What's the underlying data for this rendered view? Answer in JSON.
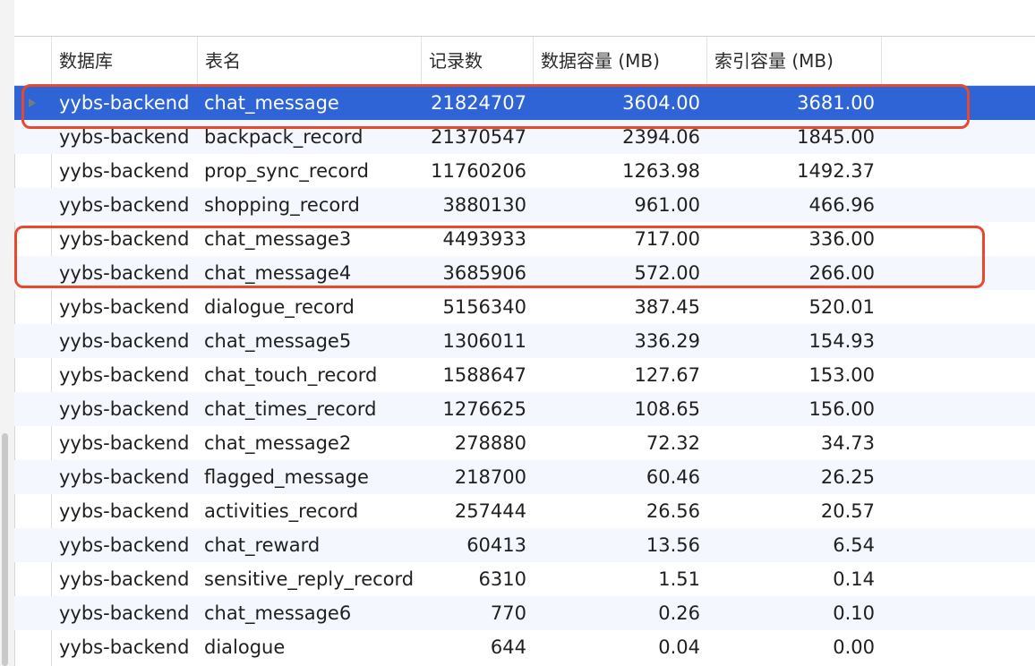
{
  "columns": {
    "database": "数据库",
    "table": "表名",
    "records": "记录数",
    "data_size": "数据容量 (MB)",
    "index_size": "索引容量 (MB)"
  },
  "rows": [
    {
      "db": "yybs-backend",
      "table": "chat_message",
      "records": "21824707",
      "data": "3604.00",
      "index": "3681.00",
      "selected": true,
      "highlighted": true
    },
    {
      "db": "yybs-backend",
      "table": "backpack_record",
      "records": "21370547",
      "data": "2394.06",
      "index": "1845.00"
    },
    {
      "db": "yybs-backend",
      "table": "prop_sync_record",
      "records": "11760206",
      "data": "1263.98",
      "index": "1492.37"
    },
    {
      "db": "yybs-backend",
      "table": "shopping_record",
      "records": "3880130",
      "data": "961.00",
      "index": "466.96"
    },
    {
      "db": "yybs-backend",
      "table": "chat_message3",
      "records": "4493933",
      "data": "717.00",
      "index": "336.00",
      "highlighted": true
    },
    {
      "db": "yybs-backend",
      "table": "chat_message4",
      "records": "3685906",
      "data": "572.00",
      "index": "266.00",
      "highlighted": true
    },
    {
      "db": "yybs-backend",
      "table": "dialogue_record",
      "records": "5156340",
      "data": "387.45",
      "index": "520.01"
    },
    {
      "db": "yybs-backend",
      "table": "chat_message5",
      "records": "1306011",
      "data": "336.29",
      "index": "154.93"
    },
    {
      "db": "yybs-backend",
      "table": "chat_touch_record",
      "records": "1588647",
      "data": "127.67",
      "index": "153.00"
    },
    {
      "db": "yybs-backend",
      "table": "chat_times_record",
      "records": "1276625",
      "data": "108.65",
      "index": "156.00"
    },
    {
      "db": "yybs-backend",
      "table": "chat_message2",
      "records": "278880",
      "data": "72.32",
      "index": "34.73"
    },
    {
      "db": "yybs-backend",
      "table": "flagged_message",
      "records": "218700",
      "data": "60.46",
      "index": "26.25"
    },
    {
      "db": "yybs-backend",
      "table": "activities_record",
      "records": "257444",
      "data": "26.56",
      "index": "20.57"
    },
    {
      "db": "yybs-backend",
      "table": "chat_reward",
      "records": "60413",
      "data": "13.56",
      "index": "6.54"
    },
    {
      "db": "yybs-backend",
      "table": "sensitive_reply_record",
      "records": "6310",
      "data": "1.51",
      "index": "0.14"
    },
    {
      "db": "yybs-backend",
      "table": "chat_message6",
      "records": "770",
      "data": "0.26",
      "index": "0.10"
    },
    {
      "db": "yybs-backend",
      "table": "dialogue",
      "records": "644",
      "data": "0.04",
      "index": "0.00"
    }
  ],
  "colors": {
    "selection": "#2f64d6",
    "alternate_row": "#f4f7fd",
    "annotation": "#e8492a"
  },
  "icons": {
    "row_marker": "triangle-right-icon"
  }
}
